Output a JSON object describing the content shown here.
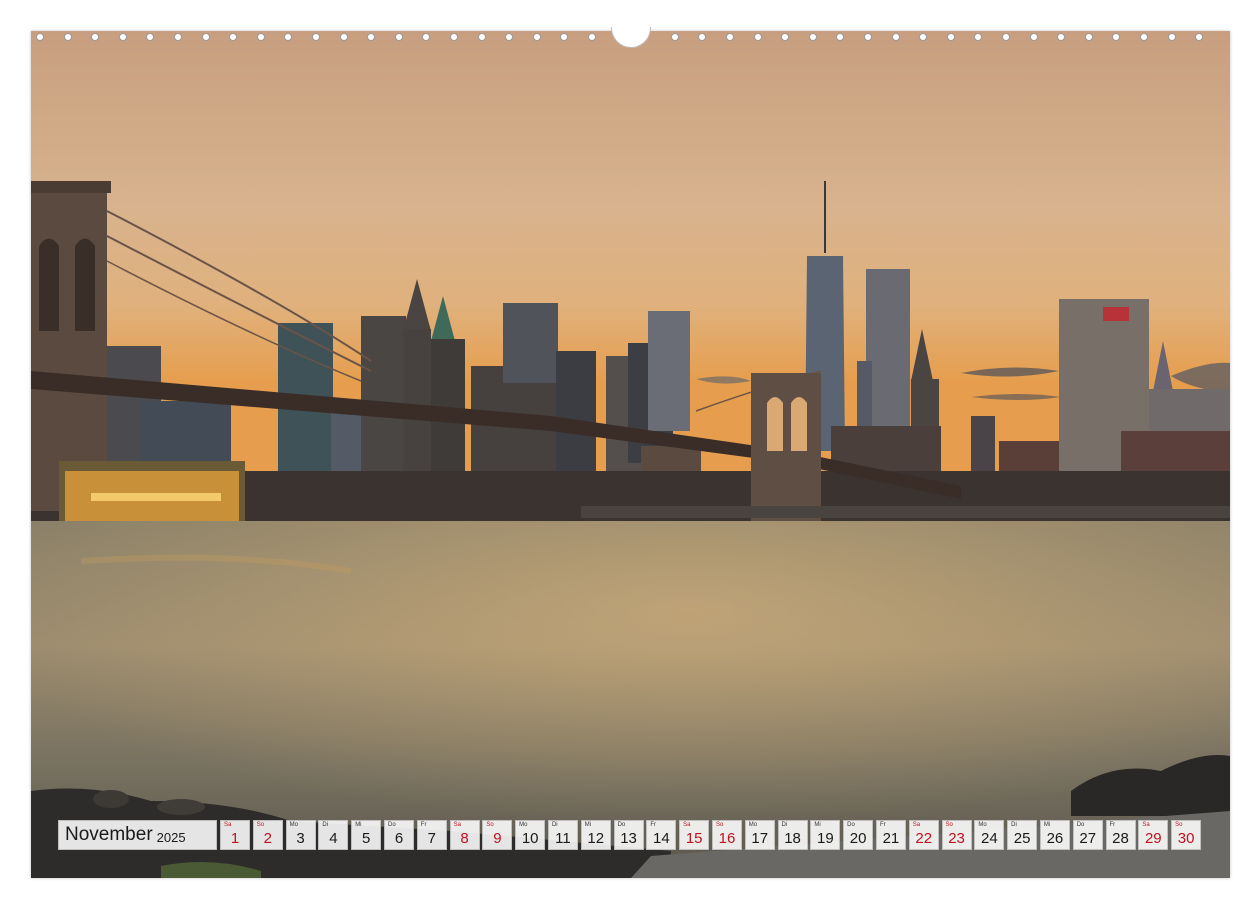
{
  "calendar": {
    "month": "November",
    "year": "2025",
    "weekend_color": "#c0111f",
    "days": [
      {
        "wd": "Sa",
        "num": "1",
        "weekend": true
      },
      {
        "wd": "So",
        "num": "2",
        "weekend": true
      },
      {
        "wd": "Mo",
        "num": "3",
        "weekend": false
      },
      {
        "wd": "Di",
        "num": "4",
        "weekend": false
      },
      {
        "wd": "Mi",
        "num": "5",
        "weekend": false
      },
      {
        "wd": "Do",
        "num": "6",
        "weekend": false
      },
      {
        "wd": "Fr",
        "num": "7",
        "weekend": false
      },
      {
        "wd": "Sa",
        "num": "8",
        "weekend": true
      },
      {
        "wd": "So",
        "num": "9",
        "weekend": true
      },
      {
        "wd": "Mo",
        "num": "10",
        "weekend": false
      },
      {
        "wd": "Di",
        "num": "11",
        "weekend": false
      },
      {
        "wd": "Mi",
        "num": "12",
        "weekend": false
      },
      {
        "wd": "Do",
        "num": "13",
        "weekend": false
      },
      {
        "wd": "Fr",
        "num": "14",
        "weekend": false
      },
      {
        "wd": "Sa",
        "num": "15",
        "weekend": true
      },
      {
        "wd": "So",
        "num": "16",
        "weekend": true
      },
      {
        "wd": "Mo",
        "num": "17",
        "weekend": false
      },
      {
        "wd": "Di",
        "num": "18",
        "weekend": false
      },
      {
        "wd": "Mi",
        "num": "19",
        "weekend": false
      },
      {
        "wd": "Do",
        "num": "20",
        "weekend": false
      },
      {
        "wd": "Fr",
        "num": "21",
        "weekend": false
      },
      {
        "wd": "Sa",
        "num": "22",
        "weekend": true
      },
      {
        "wd": "So",
        "num": "23",
        "weekend": true
      },
      {
        "wd": "Mo",
        "num": "24",
        "weekend": false
      },
      {
        "wd": "Di",
        "num": "25",
        "weekend": false
      },
      {
        "wd": "Mi",
        "num": "26",
        "weekend": false
      },
      {
        "wd": "Do",
        "num": "27",
        "weekend": false
      },
      {
        "wd": "Fr",
        "num": "28",
        "weekend": false
      },
      {
        "wd": "Sa",
        "num": "29",
        "weekend": true
      },
      {
        "wd": "So",
        "num": "30",
        "weekend": true
      }
    ]
  }
}
